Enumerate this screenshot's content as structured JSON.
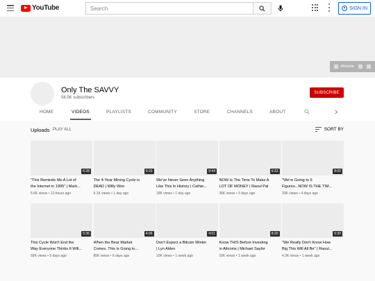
{
  "masthead": {
    "logo_text": "YouTube",
    "search_placeholder": "Search",
    "signin_label": "SIGN IN"
  },
  "banner": {
    "links": [
      "Website"
    ]
  },
  "channel": {
    "name": "Only The SAVVY",
    "subscribers": "58.5K subscribers",
    "subscribe_label": "SUBSCRIBE"
  },
  "tabs": [
    "HOME",
    "VIDEOS",
    "PLAYLISTS",
    "COMMUNITY",
    "STORE",
    "CHANNELS",
    "ABOUT"
  ],
  "active_tab": "VIDEOS",
  "section": {
    "title": "Uploads",
    "play_all": "PLAY ALL",
    "sort_label": "SORT BY"
  },
  "videos": [
    {
      "title1": "\"This Reminds Me A Lot of",
      "title2": "the Internet in 1995\" | Mark...",
      "duration": "6:28",
      "views": "5.6K views",
      "age": "13 hours ago"
    },
    {
      "title1": "The 4-Year Mining Cycle is",
      "title2": "DEAD | Willy Woo",
      "duration": "9:15",
      "views": "9.1K views",
      "age": "1 day ago"
    },
    {
      "title1": "We've Never Seen Anything",
      "title2": "Like This In History | Cathie...",
      "duration": "9:44",
      "views": "18K views",
      "age": "1 day ago"
    },
    {
      "title1": "NOW Is The Time To Make A",
      "title2": "LOT OF MONEY | Raoul Pal",
      "duration": "6:33",
      "views": "36K views",
      "age": "3 days ago"
    },
    {
      "title1": "\"We're Going to 6",
      "title2": "Figures...NOW IS THE TIM...",
      "duration": "8:05",
      "views": "33K views",
      "age": "4 days ago"
    },
    {
      "title1": "This Cycle Won't End the",
      "title2": "Way Everyone Thinks It Will...",
      "duration": "5:36",
      "views": "92K views",
      "age": "5 days ago"
    },
    {
      "title1": "When the Bear Market",
      "title2": "Comes, This Is Going to...",
      "duration": "4:06",
      "views": "85K views",
      "age": "6 days ago"
    },
    {
      "title1": "Don't Expect a Bitcoin Winter",
      "title2": "| Lyn Alden",
      "duration": "4:01",
      "views": "10K views",
      "age": "1 week ago"
    },
    {
      "title1": "Know THIS Before Investing",
      "title2": "in Altcoins | Michael Saylor",
      "duration": "8:20",
      "views": "16K views",
      "age": "1 week ago"
    },
    {
      "title1": "\"We Really Don't Know How",
      "title2": "Big This Will All Be\" | Raoul...",
      "duration": "6:30",
      "views": "4.3K views",
      "age": "1 week ago"
    }
  ],
  "colors": {
    "brand_red": "#ff0000",
    "subscribe_red": "#cc0000",
    "link_blue": "#065fd4"
  }
}
